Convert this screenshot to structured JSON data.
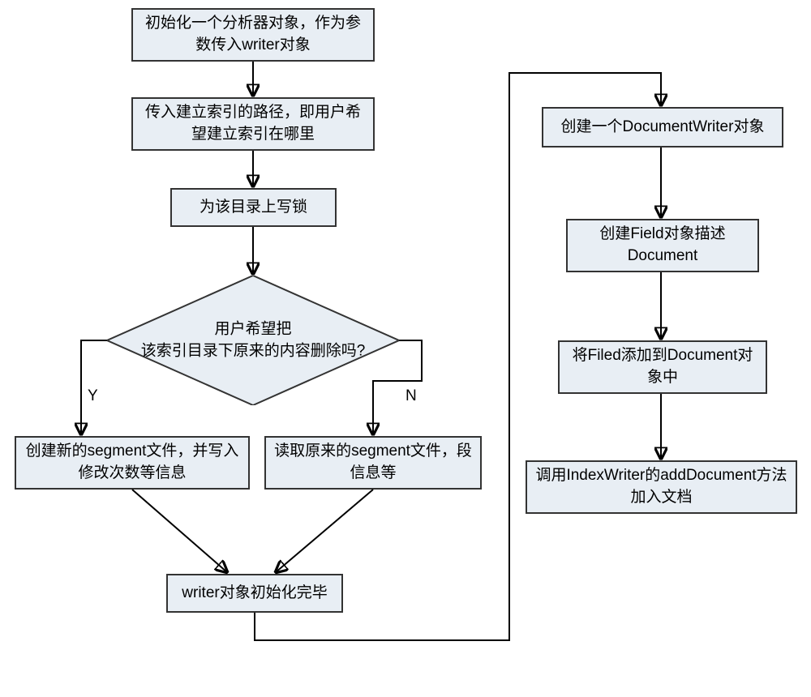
{
  "chart_data": {
    "type": "flowchart",
    "nodes": [
      {
        "id": "n1",
        "type": "process",
        "text": "初始化一个分析器对象，作为参数传入writer对象"
      },
      {
        "id": "n2",
        "type": "process",
        "text": "传入建立索引的路径，即用户希望建立索引在哪里"
      },
      {
        "id": "n3",
        "type": "process",
        "text": "为该目录上写锁"
      },
      {
        "id": "d1",
        "type": "decision",
        "text": "用户希望把该索引目录下原来的内容删除吗?"
      },
      {
        "id": "n4",
        "type": "process",
        "text": "创建新的segment文件，并写入修改次数等信息"
      },
      {
        "id": "n5",
        "type": "process",
        "text": "读取原来的segment文件，段信息等"
      },
      {
        "id": "n6",
        "type": "process",
        "text": "writer对象初始化完毕"
      },
      {
        "id": "n7",
        "type": "process",
        "text": "创建一个DocumentWriter对象"
      },
      {
        "id": "n8",
        "type": "process",
        "text": "创建Field对象描述Document"
      },
      {
        "id": "n9",
        "type": "process",
        "text": "将Filed添加到Document对象中"
      },
      {
        "id": "n10",
        "type": "process",
        "text": "调用IndexWriter的addDocument方法加入文档"
      }
    ],
    "edges": [
      {
        "from": "n1",
        "to": "n2"
      },
      {
        "from": "n2",
        "to": "n3"
      },
      {
        "from": "n3",
        "to": "d1"
      },
      {
        "from": "d1",
        "to": "n4",
        "label": "Y"
      },
      {
        "from": "d1",
        "to": "n5",
        "label": "N"
      },
      {
        "from": "n4",
        "to": "n6"
      },
      {
        "from": "n5",
        "to": "n6"
      },
      {
        "from": "n6",
        "to": "n7"
      },
      {
        "from": "n7",
        "to": "n8"
      },
      {
        "from": "n8",
        "to": "n9"
      },
      {
        "from": "n9",
        "to": "n10"
      }
    ],
    "branch_labels": {
      "yes": "Y",
      "no": "N"
    }
  },
  "nodes": {
    "n1": "初始化一个分析器对象，作为参数传入writer对象",
    "n2": "传入建立索引的路径，即用户希望建立索引在哪里",
    "n3": "为该目录上写锁",
    "d1_line1": "用户希望把",
    "d1_line2": "该索引目录下原来的内容删除吗?",
    "n4": "创建新的segment文件，并写入修改次数等信息",
    "n5": "读取原来的segment文件，段信息等",
    "n6": "writer对象初始化完毕",
    "n7": "创建一个DocumentWriter对象",
    "n8": "创建Field对象描述Document",
    "n9": "将Filed添加到Document对象中",
    "n10": "调用IndexWriter的addDocument方法加入文档"
  },
  "labels": {
    "yes": "Y",
    "no": "N"
  }
}
